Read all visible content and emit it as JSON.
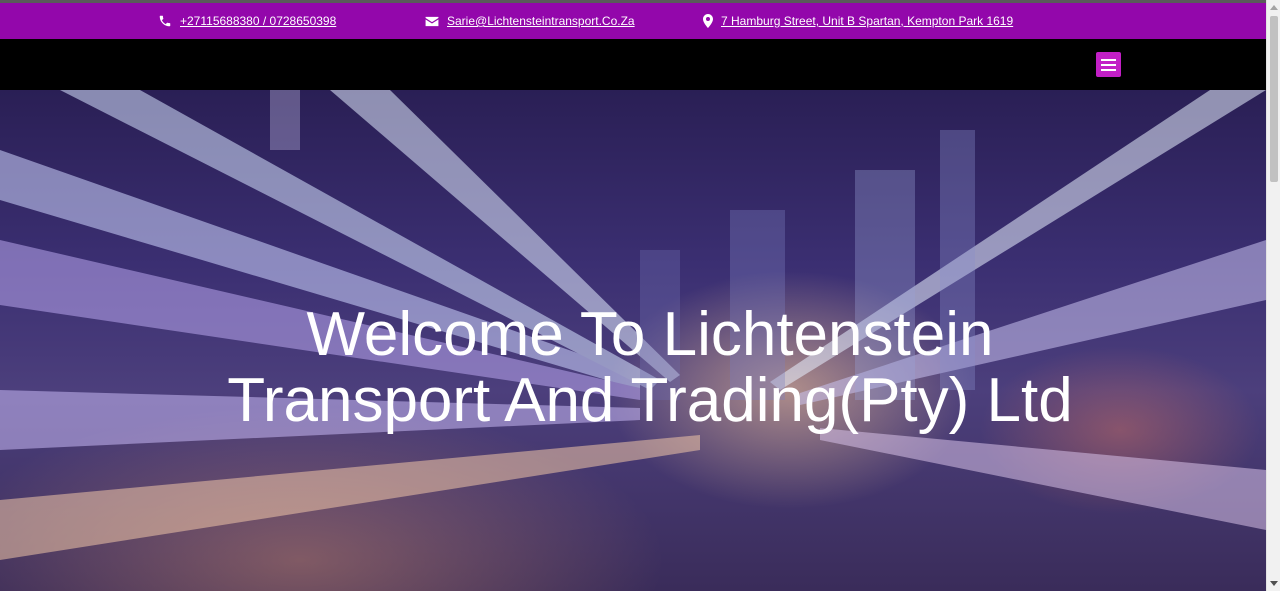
{
  "topbar": {
    "phone": "+27115688380 / 0728650398",
    "email": "Sarie@Lichtensteintransport.Co.Za",
    "address": "7 Hamburg Street, Unit B Spartan, Kempton Park 1619"
  },
  "hero": {
    "title": "Welcome To Lichtenstein Transport And Trading(Pty) Ltd"
  },
  "colors": {
    "topbar": "#9307ab",
    "navbar": "#000000",
    "menu_button": "#c21fc6"
  },
  "icons": {
    "phone": "phone-icon",
    "email": "envelope-icon",
    "address": "map-pin-icon",
    "menu": "hamburger-menu-icon"
  }
}
